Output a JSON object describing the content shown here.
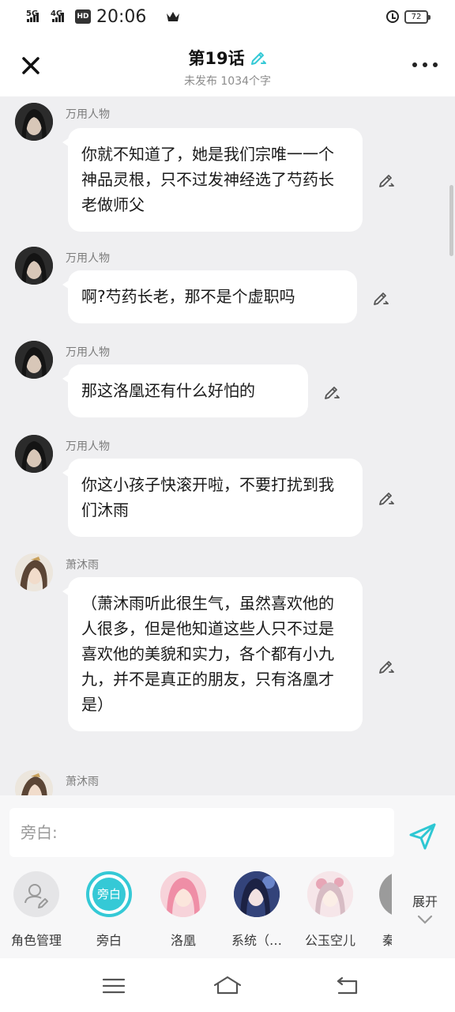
{
  "status_bar": {
    "signal_1": "5G",
    "signal_2": "4G",
    "hd_badge": "HD",
    "time": "20:06",
    "battery": "72"
  },
  "header": {
    "title": "第19话",
    "subtitle": "未发布 1034个字"
  },
  "messages": [
    {
      "name": "万用人物",
      "text": "你就不知道了，她是我们宗唯一一个神品灵根，只不过发神经选了芍药长老做师父"
    },
    {
      "name": "万用人物",
      "text": "啊?芍药长老，那不是个虚职吗"
    },
    {
      "name": "万用人物",
      "text": "那这洛凰还有什么好怕的"
    },
    {
      "name": "万用人物",
      "text": "你这小孩子快滚开啦，不要打扰到我们沐雨"
    },
    {
      "name": "萧沐雨",
      "text": "（萧沐雨听此很生气，虽然喜欢他的人很多，但是他知道这些人只不过是喜欢他的美貌和实力，各个都有小九九，并不是真正的朋友，只有洛凰才是）"
    },
    {
      "name": "萧沐雨",
      "text": ""
    }
  ],
  "input": {
    "placeholder": "旁白:"
  },
  "roles": [
    {
      "label": "角色管理",
      "icon": "role-manage-icon"
    },
    {
      "label": "旁白",
      "badge": "旁白"
    },
    {
      "label": "洛凰"
    },
    {
      "label": "系统（…"
    },
    {
      "label": "公玉空儿"
    },
    {
      "label": "秦"
    }
  ],
  "expand_label": "展开",
  "colors": {
    "accent": "#35c9d6",
    "background": "#efeff1",
    "bubble": "#ffffff",
    "name_text": "#7c7c7c"
  }
}
